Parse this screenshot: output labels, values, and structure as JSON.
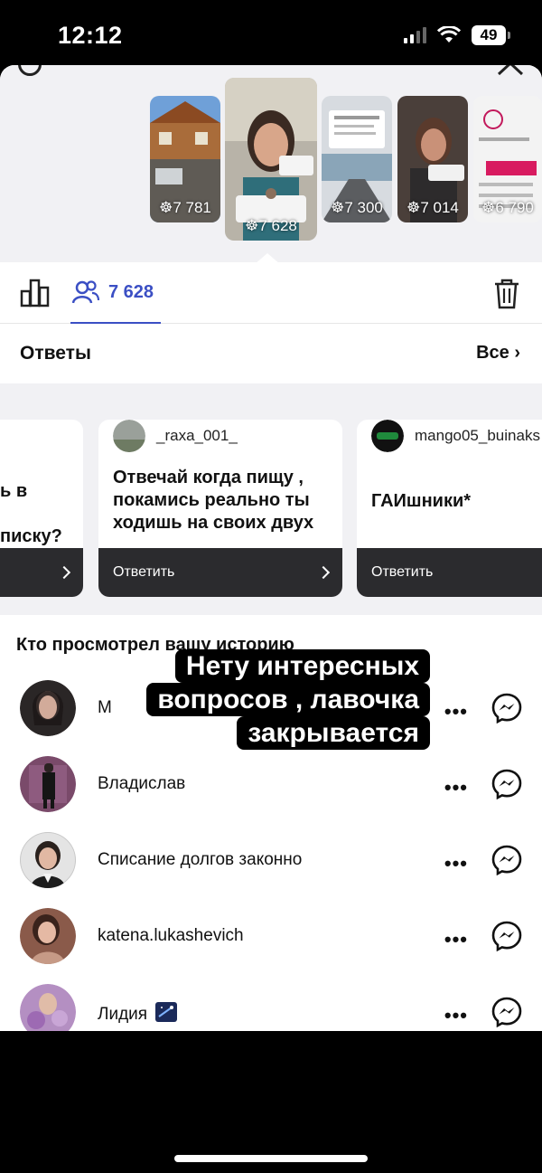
{
  "status_bar": {
    "time": "12:12",
    "battery": "49"
  },
  "stories": {
    "thumbs": [
      {
        "viewers": "7 781"
      },
      {
        "viewers": "7 628",
        "active": true
      },
      {
        "viewers": "7 300"
      },
      {
        "viewers": "7 014"
      },
      {
        "viewers": "6 790"
      }
    ]
  },
  "tabs": {
    "viewers_count": "7 628"
  },
  "answers": {
    "title": "Ответы",
    "all_label": "Все",
    "cards": [
      {
        "author": "",
        "question": "ь в\nписку?",
        "reply_label": ""
      },
      {
        "author": "_raxa_001_",
        "question": "Отвечай когда пищу , покамись реально ты ходишь на своих двух",
        "reply_label": "Ответить"
      },
      {
        "author": "mango05_buinaks",
        "question": "ГАИшники*",
        "reply_label": "Ответить"
      }
    ]
  },
  "viewers_list": {
    "title": "Кто просмотрел вашу историю",
    "items": [
      {
        "name": "М"
      },
      {
        "name": "Владислав"
      },
      {
        "name": "Списание долгов законно"
      },
      {
        "name": "katena.lukashevich"
      },
      {
        "name": "Лидия"
      }
    ]
  },
  "overlay": {
    "line1": "Нету интересных",
    "line2": "вопросов , лавочка",
    "line3": "закрывается"
  },
  "colors": {
    "accent": "#3b4fc4",
    "dark_bar": "#2b2b2e",
    "panel_bg": "#f1f1f4"
  }
}
